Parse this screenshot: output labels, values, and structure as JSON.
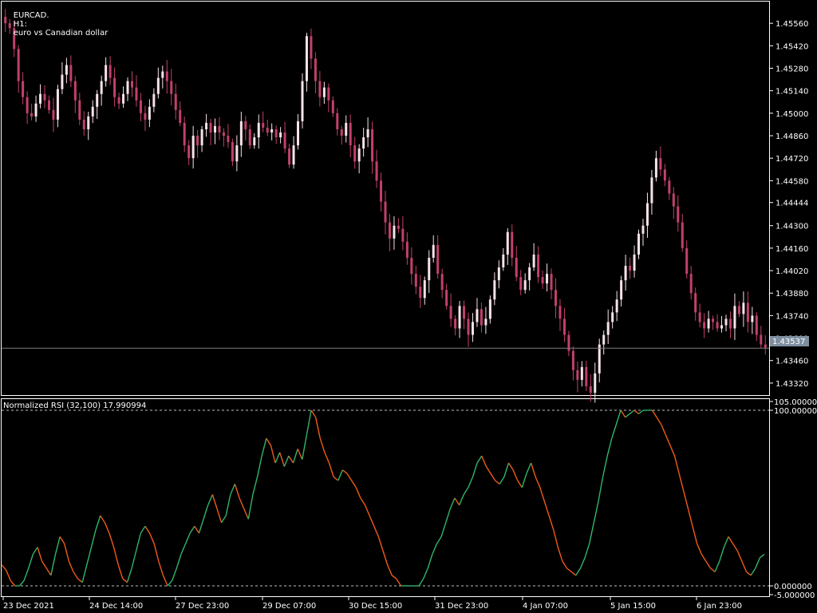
{
  "chart_title": {
    "symbol": "EURCAD.",
    "timeframe": "H1:",
    "description": "euro vs Canadian dollar"
  },
  "indicator_title": "Normalized RSI (32,100) 17.990994",
  "current_price": "1.43537",
  "colors": {
    "background": "#000000",
    "candle_bull": "#f6e3e8",
    "candle_bear": "#c2406d",
    "grid_frame": "#ffffff",
    "bid_line": "#7e7e7e",
    "price_tag_bg": "#7e8fa0",
    "rsi_up": "#2fb56b",
    "rsi_down": "#f05a18",
    "level_line": "#bfbfbf"
  },
  "price_axis_labels": [
    "1.45560",
    "1.45420",
    "1.45280",
    "1.45140",
    "1.45000",
    "1.44860",
    "1.44720",
    "1.44580",
    "1.44444",
    "1.44300",
    "1.44160",
    "1.44020",
    "1.43880",
    "1.43740",
    "1.43600",
    "1.43460",
    "1.43320"
  ],
  "rsi_axis_labels": [
    "105.000000",
    "100.000000",
    "0.000000",
    "-5.000000"
  ],
  "time_labels": [
    "23 Dec 2021",
    "24 Dec 14:00",
    "27 Dec 23:00",
    "29 Dec 07:00",
    "30 Dec 15:00",
    "31 Dec 23:00",
    "4 Jan 07:00",
    "5 Jan 15:00",
    "6 Jan 23:00"
  ],
  "chart_data": [
    {
      "type": "candlestick",
      "title": "EURCAD., H1: euro vs Canadian dollar",
      "ylim": [
        1.4325,
        1.4569
      ],
      "bid_line": 1.43537,
      "x": [
        "23 Dec 2021",
        "24 Dec 14:00",
        "27 Dec 23:00",
        "29 Dec 07:00",
        "30 Dec 15:00",
        "31 Dec 23:00",
        "4 Jan 07:00",
        "5 Jan 15:00",
        "6 Jan 23:00"
      ],
      "close_path": [
        1.4556,
        1.4553,
        1.454,
        1.452,
        1.451,
        1.45,
        1.4498,
        1.4506,
        1.4512,
        1.4508,
        1.4502,
        1.4496,
        1.4515,
        1.4524,
        1.453,
        1.452,
        1.4508,
        1.4496,
        1.449,
        1.4498,
        1.4504,
        1.4512,
        1.452,
        1.453,
        1.4522,
        1.451,
        1.4506,
        1.4512,
        1.452,
        1.4516,
        1.4508,
        1.45,
        1.4496,
        1.4504,
        1.4512,
        1.4522,
        1.4526,
        1.452,
        1.4512,
        1.4502,
        1.4494,
        1.448,
        1.4472,
        1.4486,
        1.448,
        1.449,
        1.4494,
        1.4488,
        1.4492,
        1.4488,
        1.4486,
        1.4482,
        1.447,
        1.448,
        1.4495,
        1.449,
        1.448,
        1.4485,
        1.4494,
        1.4491,
        1.4488,
        1.449,
        1.4485,
        1.4488,
        1.4478,
        1.4468,
        1.448,
        1.4495,
        1.452,
        1.4548,
        1.4534,
        1.452,
        1.451,
        1.4516,
        1.4508,
        1.45,
        1.449,
        1.4486,
        1.4494,
        1.448,
        1.447,
        1.4478,
        1.4485,
        1.449,
        1.447,
        1.4458,
        1.4445,
        1.4432,
        1.4422,
        1.443,
        1.4428,
        1.442,
        1.441,
        1.44,
        1.4392,
        1.4385,
        1.4396,
        1.441,
        1.4418,
        1.44,
        1.439,
        1.438,
        1.4372,
        1.4366,
        1.438,
        1.4372,
        1.4362,
        1.437,
        1.4378,
        1.4368,
        1.4372,
        1.4384,
        1.4396,
        1.4404,
        1.4412,
        1.4426,
        1.441,
        1.4398,
        1.439,
        1.4396,
        1.4404,
        1.4412,
        1.4398,
        1.4394,
        1.44,
        1.439,
        1.438,
        1.4372,
        1.4362,
        1.4352,
        1.434,
        1.4334,
        1.4342,
        1.433,
        1.4326,
        1.4338,
        1.4356,
        1.4362,
        1.437,
        1.4376,
        1.4384,
        1.4396,
        1.4405,
        1.4402,
        1.4412,
        1.4425,
        1.443,
        1.4444,
        1.446,
        1.4472,
        1.4465,
        1.4458,
        1.445,
        1.4442,
        1.4432,
        1.4416,
        1.44,
        1.4388,
        1.4376,
        1.437,
        1.4366,
        1.4372,
        1.437,
        1.4366,
        1.4368,
        1.4372,
        1.4366,
        1.438,
        1.4375,
        1.4382,
        1.437,
        1.4374,
        1.4362,
        1.4356,
        1.4354
      ]
    },
    {
      "type": "line",
      "title": "Normalized RSI (32,100) 17.990994",
      "ylim": [
        -5,
        105
      ],
      "levels": [
        0,
        100
      ],
      "y": [
        12,
        9,
        3,
        0,
        0,
        3,
        10,
        18,
        22,
        14,
        10,
        6,
        18,
        28,
        24,
        14,
        8,
        4,
        2,
        12,
        22,
        32,
        40,
        36,
        30,
        22,
        12,
        4,
        2,
        10,
        20,
        30,
        34,
        30,
        24,
        14,
        6,
        0,
        3,
        10,
        18,
        24,
        30,
        34,
        30,
        38,
        46,
        52,
        44,
        36,
        40,
        52,
        58,
        50,
        44,
        38,
        52,
        62,
        74,
        84,
        80,
        70,
        76,
        68,
        74,
        70,
        78,
        72,
        86,
        100,
        96,
        84,
        76,
        70,
        62,
        60,
        66,
        64,
        60,
        56,
        50,
        46,
        40,
        34,
        28,
        20,
        12,
        6,
        4,
        0,
        0,
        0,
        0,
        0,
        4,
        10,
        18,
        24,
        28,
        36,
        44,
        50,
        46,
        52,
        56,
        62,
        70,
        74,
        68,
        64,
        60,
        58,
        62,
        70,
        66,
        60,
        56,
        64,
        70,
        62,
        56,
        48,
        40,
        32,
        22,
        14,
        10,
        8,
        6,
        10,
        16,
        24,
        36,
        48,
        62,
        74,
        84,
        92,
        100,
        96,
        98,
        100,
        98,
        100,
        100,
        100,
        96,
        92,
        86,
        80,
        74,
        64,
        54,
        44,
        34,
        24,
        18,
        14,
        10,
        8,
        14,
        22,
        28,
        24,
        20,
        14,
        8,
        6,
        10,
        16,
        18
      ]
    }
  ]
}
